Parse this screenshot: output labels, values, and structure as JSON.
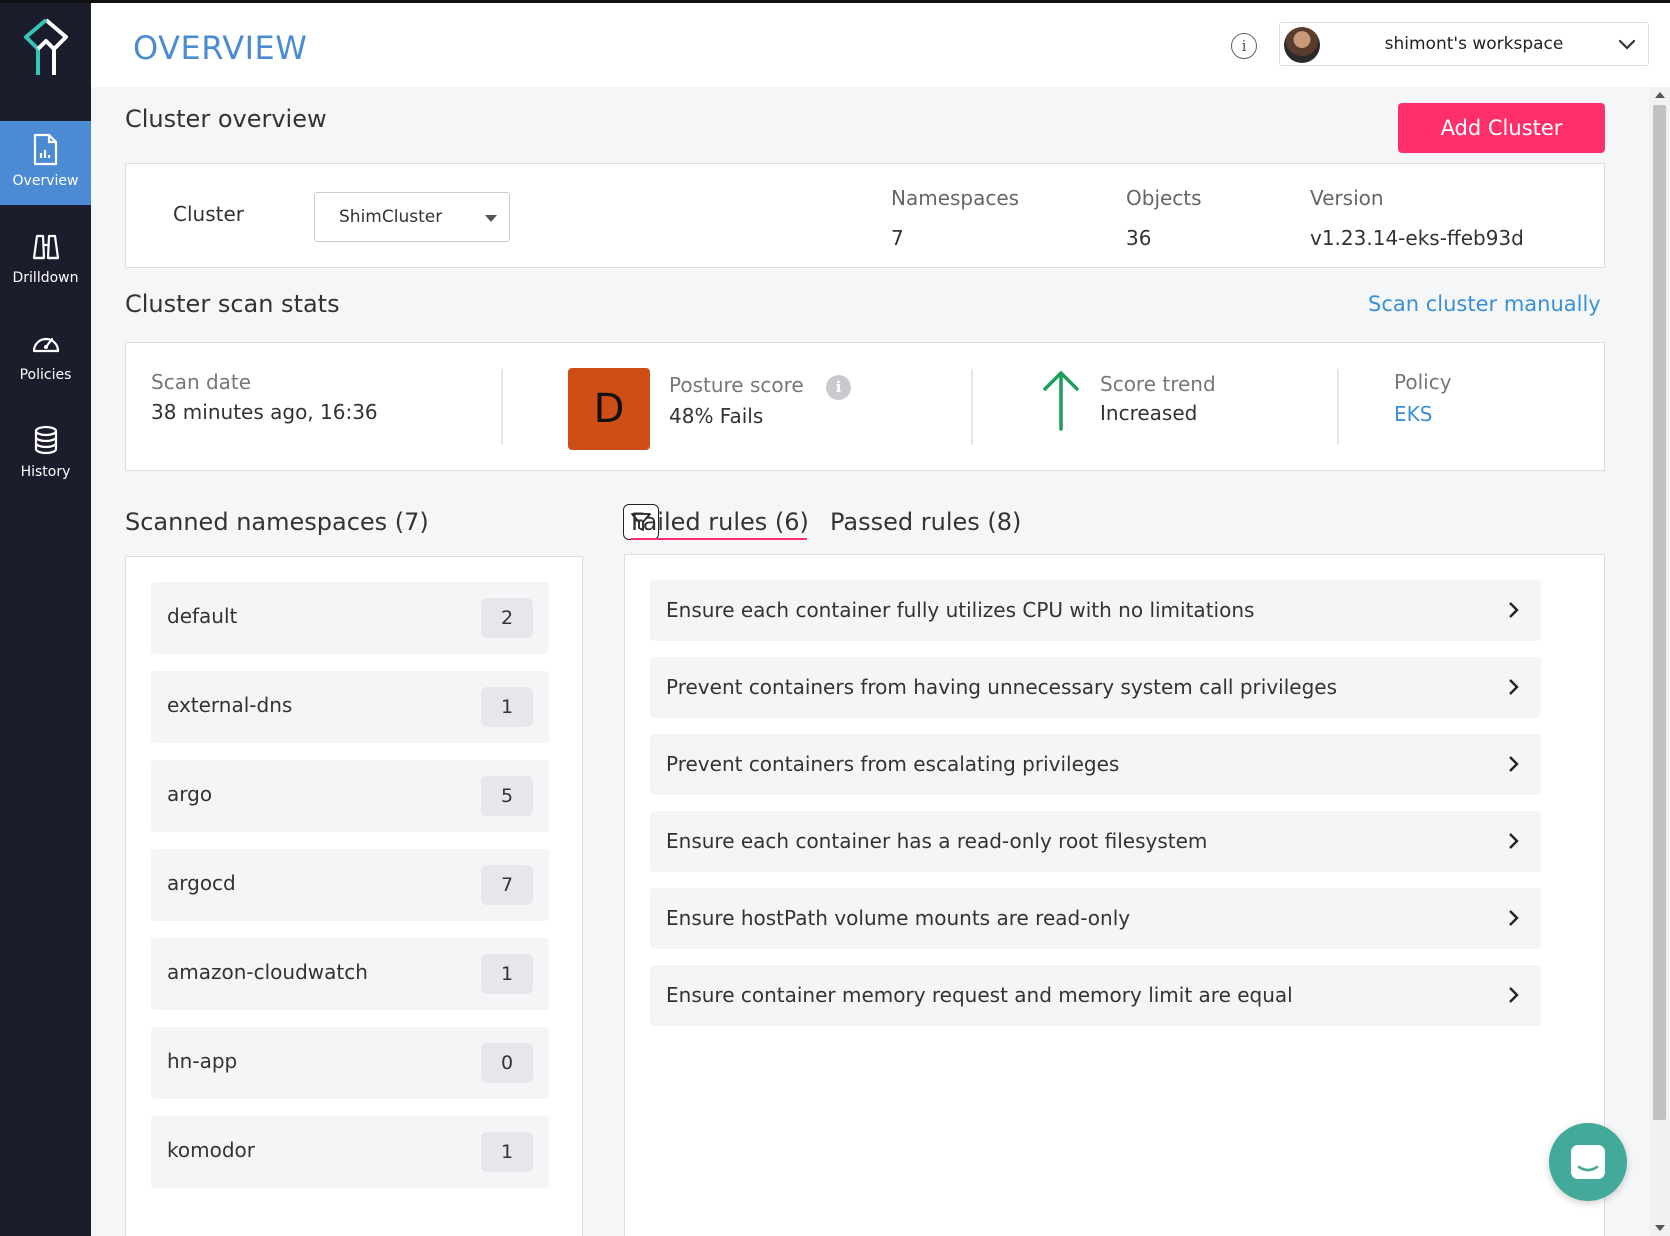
{
  "sidebar": {
    "items": [
      {
        "label": "Overview",
        "icon": "document-chart-icon",
        "active": true
      },
      {
        "label": "Drilldown",
        "icon": "binoculars-icon"
      },
      {
        "label": "Policies",
        "icon": "gauge-icon"
      },
      {
        "label": "History",
        "icon": "database-icon"
      }
    ]
  },
  "header": {
    "title": "OVERVIEW",
    "workspace": "shimont's workspace"
  },
  "cluster_overview": {
    "title": "Cluster overview",
    "add_button": "Add Cluster",
    "cluster_label": "Cluster",
    "cluster_value": "ShimCluster",
    "stats": [
      {
        "label": "Namespaces",
        "value": "7"
      },
      {
        "label": "Objects",
        "value": "36"
      },
      {
        "label": "Version",
        "value": "v1.23.14-eks-ffeb93d"
      }
    ]
  },
  "scan_stats": {
    "title": "Cluster scan stats",
    "scan_link": "Scan cluster manually",
    "scan_date_label": "Scan date",
    "scan_date_value": "38 minutes ago, 16:36",
    "grade": "D",
    "grade_color": "#cf4e16",
    "posture_label": "Posture score",
    "posture_value": "48% Fails",
    "trend_label": "Score trend",
    "trend_value": "Increased",
    "trend_color": "#1e9e5a",
    "policy_label": "Policy",
    "policy_value": "EKS"
  },
  "namespaces": {
    "title": "Scanned namespaces (7)",
    "items": [
      {
        "name": "default",
        "count": "2"
      },
      {
        "name": "external-dns",
        "count": "1"
      },
      {
        "name": "argo",
        "count": "5"
      },
      {
        "name": "argocd",
        "count": "7"
      },
      {
        "name": "amazon-cloudwatch",
        "count": "1"
      },
      {
        "name": "hn-app",
        "count": "0"
      },
      {
        "name": "komodor",
        "count": "1"
      }
    ]
  },
  "rules": {
    "tabs": [
      {
        "label": "Failed rules (6)",
        "active": true
      },
      {
        "label": "Passed rules (8)",
        "active": false
      }
    ],
    "failed": [
      "Ensure each container fully utilizes CPU with no limitations",
      "Prevent containers from having unnecessary system call privileges",
      "Prevent containers from escalating privileges",
      "Ensure each container has a read-only root filesystem",
      "Ensure hostPath volume mounts are read-only",
      "Ensure container memory request and memory limit are equal"
    ]
  },
  "colors": {
    "accent": "#4a8bd4",
    "brand_pink": "#ff2f6c",
    "sidebar_bg": "#1c1d2c",
    "link": "#3b8fd9"
  }
}
